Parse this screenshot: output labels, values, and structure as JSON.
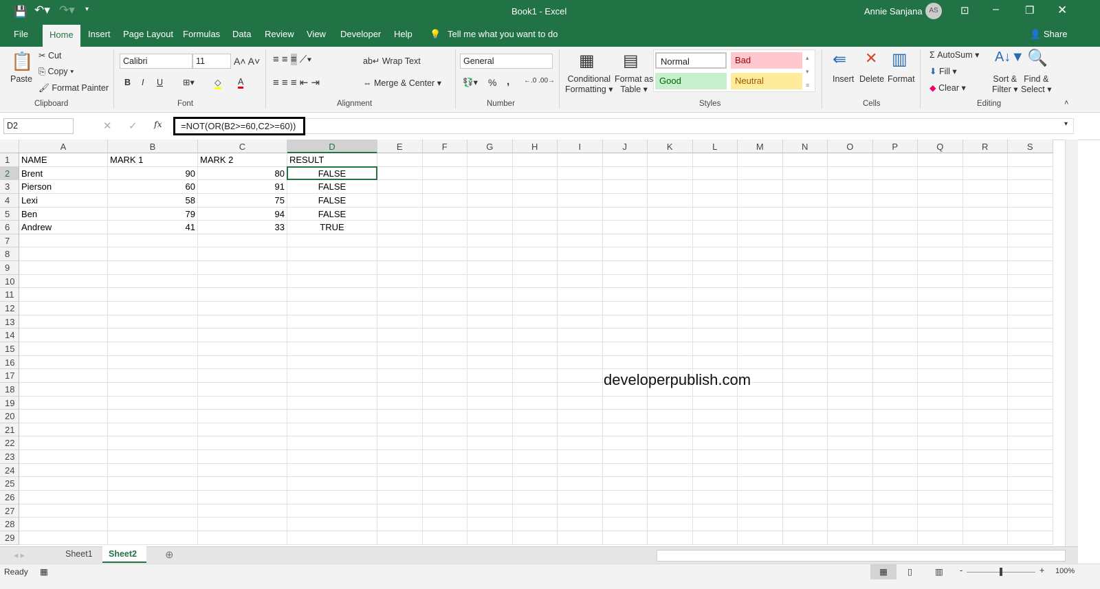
{
  "title": {
    "doc": "Book1  -  Excel",
    "user": "Annie Sanjana",
    "initials": "AS"
  },
  "tabs": [
    "File",
    "Home",
    "Insert",
    "Page Layout",
    "Formulas",
    "Data",
    "Review",
    "View",
    "Developer",
    "Help"
  ],
  "tell_me": "Tell me what you want to do",
  "share": "Share",
  "clipboard": {
    "paste": "Paste",
    "cut": "Cut",
    "copy": "Copy",
    "format_painter": "Format Painter",
    "label": "Clipboard"
  },
  "font": {
    "name": "Calibri",
    "size": "11",
    "label": "Font",
    "bold": "B",
    "italic": "I",
    "underline": "U"
  },
  "alignment": {
    "wrap": "Wrap Text",
    "merge": "Merge & Center",
    "label": "Alignment"
  },
  "number": {
    "format": "General",
    "label": "Number",
    "percent": "%",
    "comma": ","
  },
  "styles": {
    "cond1": "Conditional",
    "cond2": "Formatting",
    "fat1": "Format as",
    "fat2": "Table",
    "normal": "Normal",
    "bad": "Bad",
    "good": "Good",
    "neutral": "Neutral",
    "label": "Styles"
  },
  "cells": {
    "insert": "Insert",
    "delete": "Delete",
    "format": "Format",
    "label": "Cells"
  },
  "editing": {
    "autosum": "AutoSum",
    "fill": "Fill",
    "clear": "Clear",
    "sort1": "Sort &",
    "sort2": "Filter",
    "find1": "Find &",
    "find2": "Select",
    "label": "Editing"
  },
  "formula_bar": {
    "name_box": "D2",
    "fx": "fx",
    "formula": "=NOT(OR(B2>=60,C2>=60))"
  },
  "columns": [
    "A",
    "B",
    "C",
    "D",
    "E",
    "F",
    "G",
    "H",
    "I",
    "J",
    "K",
    "L",
    "M",
    "N",
    "O",
    "P",
    "Q",
    "R",
    "S"
  ],
  "rows": 29,
  "cells_data": [
    [
      "NAME",
      "MARK 1",
      "MARK 2",
      "RESULT"
    ],
    [
      "Brent",
      "90",
      "80",
      "FALSE"
    ],
    [
      "Pierson",
      "60",
      "91",
      "FALSE"
    ],
    [
      "Lexi",
      "58",
      "75",
      "FALSE"
    ],
    [
      "Ben",
      "79",
      "94",
      "FALSE"
    ],
    [
      "Andrew",
      "41",
      "33",
      "TRUE"
    ]
  ],
  "watermark": "developerpublish.com",
  "sheets": [
    "Sheet1",
    "Sheet2"
  ],
  "active_sheet": "Sheet2",
  "status": {
    "ready": "Ready",
    "zoom": "100%"
  }
}
